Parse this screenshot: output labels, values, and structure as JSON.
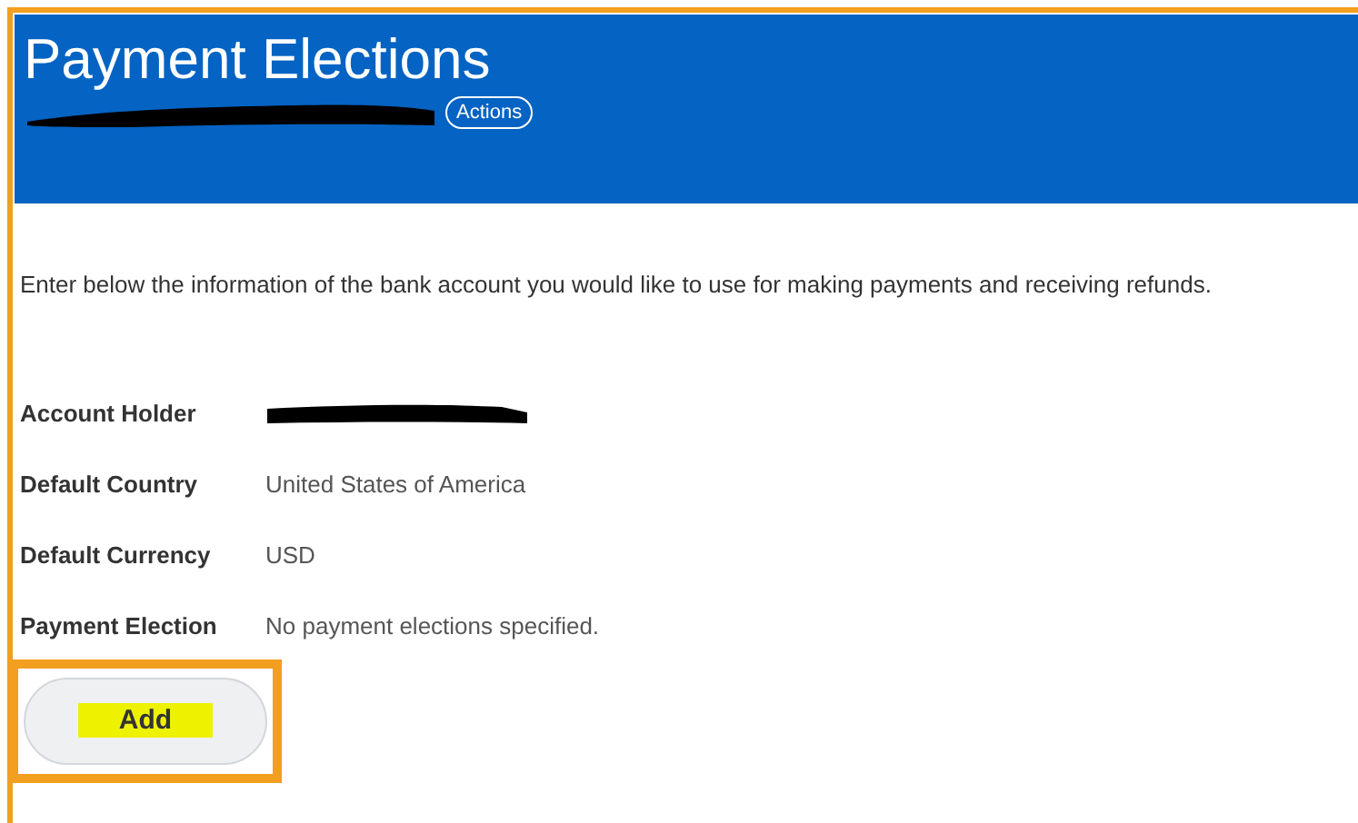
{
  "header": {
    "title": "Payment Elections",
    "actions_button": "Actions"
  },
  "description": "Enter below the information of the bank account you would like to use for making payments and receiving refunds.",
  "fields": [
    {
      "label": "Account Holder",
      "kind": "redacted"
    },
    {
      "label": "Default Country",
      "kind": "text",
      "value": "United States of America"
    },
    {
      "label": "Default Currency",
      "kind": "text",
      "value": "USD"
    },
    {
      "label": "Payment Election",
      "kind": "text",
      "value": "No payment elections specified."
    }
  ],
  "add_button": {
    "label": "Add",
    "annotated": true
  }
}
